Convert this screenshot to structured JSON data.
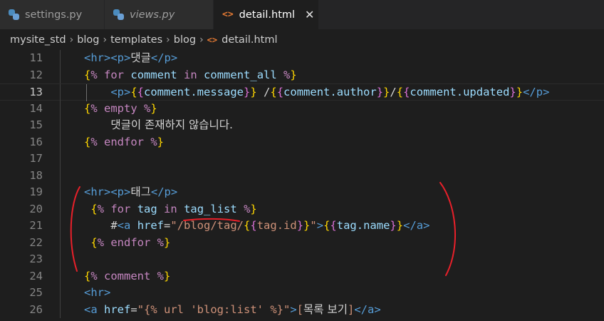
{
  "tabs": [
    {
      "label": "settings.py",
      "icon": "python-icon",
      "italic": false
    },
    {
      "label": "views.py",
      "icon": "python-icon",
      "italic": true
    },
    {
      "label": "detail.html",
      "icon": "html-icon",
      "active": true
    }
  ],
  "tab_close_glyph": "✕",
  "html_icon_glyph": "<>",
  "breadcrumb": [
    "mysite_std",
    "blog",
    "templates",
    "blog",
    "detail.html"
  ],
  "current_line": 13,
  "lines": [
    {
      "n": "11",
      "tokens": [
        [
          "tg",
          "<hr>"
        ],
        [
          "tg",
          "<p>"
        ],
        [
          "kr",
          "댓글"
        ],
        [
          "tg",
          "</p>"
        ]
      ]
    },
    {
      "n": "12",
      "tokens": [
        [
          "br",
          "{"
        ],
        [
          "kw",
          "% for"
        ],
        [
          "tx",
          " "
        ],
        [
          "vr",
          "comment"
        ],
        [
          "tx",
          " "
        ],
        [
          "kw",
          "in"
        ],
        [
          "tx",
          " "
        ],
        [
          "vr",
          "comment_all"
        ],
        [
          "tx",
          " "
        ],
        [
          "kw",
          "%"
        ],
        [
          "br",
          "}"
        ]
      ]
    },
    {
      "n": "13",
      "tokens": [
        [
          "tx",
          "    "
        ],
        [
          "tg",
          "<p>"
        ],
        [
          "br",
          "{"
        ],
        [
          "bp",
          "{"
        ],
        [
          "vr",
          "comment.message"
        ],
        [
          "bp",
          "}"
        ],
        [
          "br",
          "}"
        ],
        [
          "tx",
          " /"
        ],
        [
          "br",
          "{"
        ],
        [
          "bp",
          "{"
        ],
        [
          "vr",
          "comment.author"
        ],
        [
          "bp",
          "}"
        ],
        [
          "br",
          "}"
        ],
        [
          "tx",
          "/"
        ],
        [
          "br",
          "{"
        ],
        [
          "bp",
          "{"
        ],
        [
          "vr",
          "comment.updated"
        ],
        [
          "bp",
          "}"
        ],
        [
          "br",
          "}"
        ],
        [
          "tg",
          "</p>"
        ]
      ]
    },
    {
      "n": "14",
      "tokens": [
        [
          "br",
          "{"
        ],
        [
          "kw",
          "% empty %"
        ],
        [
          "br",
          "}"
        ]
      ]
    },
    {
      "n": "15",
      "tokens": [
        [
          "tx",
          "    "
        ],
        [
          "kr",
          "댓글이 존재하지 않습니다."
        ]
      ]
    },
    {
      "n": "16",
      "tokens": [
        [
          "br",
          "{"
        ],
        [
          "kw",
          "% endfor %"
        ],
        [
          "br",
          "}"
        ]
      ]
    },
    {
      "n": "17",
      "tokens": []
    },
    {
      "n": "18",
      "tokens": []
    },
    {
      "n": "19",
      "tokens": [
        [
          "tg",
          "<hr>"
        ],
        [
          "tg",
          "<p>"
        ],
        [
          "kr",
          "태그"
        ],
        [
          "tg",
          "</p>"
        ]
      ]
    },
    {
      "n": "20",
      "tokens": [
        [
          "tx",
          " "
        ],
        [
          "br",
          "{"
        ],
        [
          "kw",
          "% for"
        ],
        [
          "tx",
          " "
        ],
        [
          "vr",
          "tag"
        ],
        [
          "tx",
          " "
        ],
        [
          "kw",
          "in"
        ],
        [
          "tx",
          " "
        ],
        [
          "vr",
          "tag_list"
        ],
        [
          "tx",
          " "
        ],
        [
          "kw",
          "%"
        ],
        [
          "br",
          "}"
        ]
      ]
    },
    {
      "n": "21",
      "tokens": [
        [
          "tx",
          "    #"
        ],
        [
          "tg",
          "<a"
        ],
        [
          "tx",
          " "
        ],
        [
          "at",
          "href"
        ],
        [
          "tx",
          "="
        ],
        [
          "st",
          "\"/blog/tag/"
        ],
        [
          "br",
          "{"
        ],
        [
          "bp",
          "{"
        ],
        [
          "st",
          "tag.id"
        ],
        [
          "bp",
          "}"
        ],
        [
          "br",
          "}"
        ],
        [
          "st",
          "\""
        ],
        [
          "tg",
          ">"
        ],
        [
          "br",
          "{"
        ],
        [
          "bp",
          "{"
        ],
        [
          "vr",
          "tag.name"
        ],
        [
          "bp",
          "}"
        ],
        [
          "br",
          "}"
        ],
        [
          "tg",
          "</a>"
        ]
      ]
    },
    {
      "n": "22",
      "tokens": [
        [
          "tx",
          " "
        ],
        [
          "br",
          "{"
        ],
        [
          "kw",
          "% endfor %"
        ],
        [
          "br",
          "}"
        ]
      ]
    },
    {
      "n": "23",
      "tokens": []
    },
    {
      "n": "24",
      "tokens": [
        [
          "br",
          "{"
        ],
        [
          "kw",
          "% comment %"
        ],
        [
          "br",
          "}"
        ]
      ]
    },
    {
      "n": "25",
      "tokens": [
        [
          "tg",
          "<hr>"
        ]
      ]
    },
    {
      "n": "26",
      "tokens": [
        [
          "tg",
          "<a"
        ],
        [
          "tx",
          " "
        ],
        [
          "at",
          "href"
        ],
        [
          "tx",
          "="
        ],
        [
          "st",
          "\"{% url 'blog:list' %}\""
        ],
        [
          "tg",
          ">"
        ],
        [
          "st",
          "["
        ],
        [
          "kr",
          "목록 보기"
        ],
        [
          "st",
          "]"
        ],
        [
          "tg",
          "</a>"
        ]
      ]
    }
  ],
  "colors": {
    "background": "#1e1e1e",
    "tag": "#569cd6",
    "keyword": "#c586c0",
    "variable": "#9cdcfe",
    "string": "#ce9178",
    "bracket_outer": "#ffd700",
    "bracket_inner": "#da70d6",
    "annotation": "#e8202a"
  }
}
